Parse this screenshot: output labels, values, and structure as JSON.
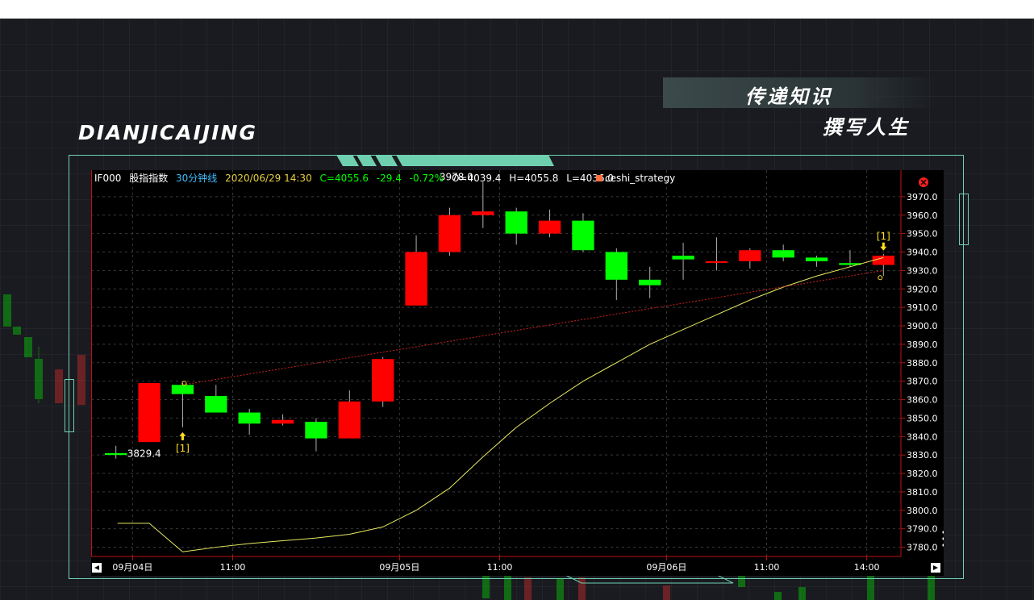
{
  "brand": "DIANJICAIJING",
  "slogan": {
    "line1": "传递知识",
    "line2": "撰写人生"
  },
  "header": {
    "symbol": "IF000",
    "name": "股指指数",
    "period": "30分钟线",
    "datetime": "2020/06/29 14:30",
    "close": "C=4055.6",
    "change": "-29.4",
    "change_pct": "-0.72%",
    "open": "O=4039.4",
    "high": "H=4055.8",
    "low": "L=4036.0",
    "strategy": "ceshi_strategy"
  },
  "colors": {
    "up": "#ff0000",
    "down": "#00ff00",
    "ma": "#e8e860",
    "accent": "#6fd0b0"
  },
  "chart_data": {
    "type": "candlestick",
    "ylim": [
      3775,
      3980
    ],
    "y_ticks": [
      3780,
      3790,
      3800,
      3810,
      3820,
      3830,
      3840,
      3850,
      3860,
      3870,
      3880,
      3890,
      3900,
      3910,
      3920,
      3930,
      3940,
      3950,
      3960,
      3970
    ],
    "x_labels": [
      {
        "index": 1,
        "label": "09月04日"
      },
      {
        "index": 4,
        "label": "11:00"
      },
      {
        "index": 9,
        "label": "09月05日"
      },
      {
        "index": 12,
        "label": "11:00"
      },
      {
        "index": 17,
        "label": "09月06日"
      },
      {
        "index": 20,
        "label": "11:00"
      },
      {
        "index": 23,
        "label": "14:00"
      }
    ],
    "candles": [
      {
        "o": 3831,
        "h": 3835,
        "l": 3828,
        "c": 3830
      },
      {
        "o": 3837,
        "h": 3869,
        "l": 3837,
        "c": 3869
      },
      {
        "o": 3868,
        "h": 3869,
        "l": 3845,
        "c": 3863
      },
      {
        "o": 3862,
        "h": 3868,
        "l": 3853,
        "c": 3853
      },
      {
        "o": 3853,
        "h": 3855,
        "l": 3841,
        "c": 3847
      },
      {
        "o": 3847,
        "h": 3852,
        "l": 3846,
        "c": 3849
      },
      {
        "o": 3848,
        "h": 3850,
        "l": 3832,
        "c": 3839
      },
      {
        "o": 3839,
        "h": 3865,
        "l": 3839,
        "c": 3859
      },
      {
        "o": 3859,
        "h": 3883,
        "l": 3856,
        "c": 3882
      },
      {
        "o": 3911,
        "h": 3949,
        "l": 3911,
        "c": 3940
      },
      {
        "o": 3940,
        "h": 3964,
        "l": 3938,
        "c": 3960
      },
      {
        "o": 3960,
        "h": 3978,
        "l": 3953,
        "c": 3962
      },
      {
        "o": 3962,
        "h": 3964,
        "l": 3944,
        "c": 3950
      },
      {
        "o": 3950,
        "h": 3963,
        "l": 3948,
        "c": 3957
      },
      {
        "o": 3957,
        "h": 3961,
        "l": 3940,
        "c": 3941
      },
      {
        "o": 3940,
        "h": 3942,
        "l": 3914,
        "c": 3925
      },
      {
        "o": 3925,
        "h": 3932,
        "l": 3915,
        "c": 3922
      },
      {
        "o": 3938,
        "h": 3945,
        "l": 3925,
        "c": 3936
      },
      {
        "o": 3935,
        "h": 3948,
        "l": 3930,
        "c": 3935
      },
      {
        "o": 3935,
        "h": 3942,
        "l": 3931,
        "c": 3941
      },
      {
        "o": 3941,
        "h": 3944,
        "l": 3935,
        "c": 3937
      },
      {
        "o": 3937,
        "h": 3938,
        "l": 3932,
        "c": 3935
      },
      {
        "o": 3934,
        "h": 3941,
        "l": 3932,
        "c": 3933
      },
      {
        "o": 3933,
        "h": 3939,
        "l": 3927,
        "c": 3938
      }
    ],
    "ma_line": [
      {
        "x": 0.55,
        "y": 3793
      },
      {
        "x": 1.5,
        "y": 3793
      },
      {
        "x": 2.5,
        "y": 3777.5
      },
      {
        "x": 3.5,
        "y": 3780
      },
      {
        "x": 4.5,
        "y": 3782
      },
      {
        "x": 5.5,
        "y": 3783.5
      },
      {
        "x": 6.5,
        "y": 3785
      },
      {
        "x": 7.5,
        "y": 3787
      },
      {
        "x": 8.5,
        "y": 3791
      },
      {
        "x": 9.5,
        "y": 3800
      },
      {
        "x": 10.5,
        "y": 3812
      },
      {
        "x": 11.5,
        "y": 3829
      },
      {
        "x": 12.5,
        "y": 3845
      },
      {
        "x": 13.5,
        "y": 3858
      },
      {
        "x": 14.5,
        "y": 3870
      },
      {
        "x": 15.5,
        "y": 3880
      },
      {
        "x": 16.5,
        "y": 3890
      },
      {
        "x": 17.5,
        "y": 3898
      },
      {
        "x": 18.5,
        "y": 3906
      },
      {
        "x": 19.5,
        "y": 3914
      },
      {
        "x": 20.5,
        "y": 3921
      },
      {
        "x": 21.5,
        "y": 3927
      },
      {
        "x": 22.5,
        "y": 3932
      },
      {
        "x": 23.5,
        "y": 3937
      }
    ],
    "trend_line": [
      {
        "x": 2.5,
        "y": 3868
      },
      {
        "x": 23.5,
        "y": 3930
      }
    ],
    "annotations": [
      {
        "index": 0,
        "value": 3829.4,
        "label": "3829.4",
        "side": "right"
      },
      {
        "index": 11,
        "value": 3978.0,
        "label": "3978.0",
        "side": "left"
      }
    ],
    "signals": [
      {
        "index": 2,
        "direction": "buy",
        "label": "[1]"
      },
      {
        "index": 23,
        "direction": "sell",
        "label": "[1]"
      }
    ]
  }
}
